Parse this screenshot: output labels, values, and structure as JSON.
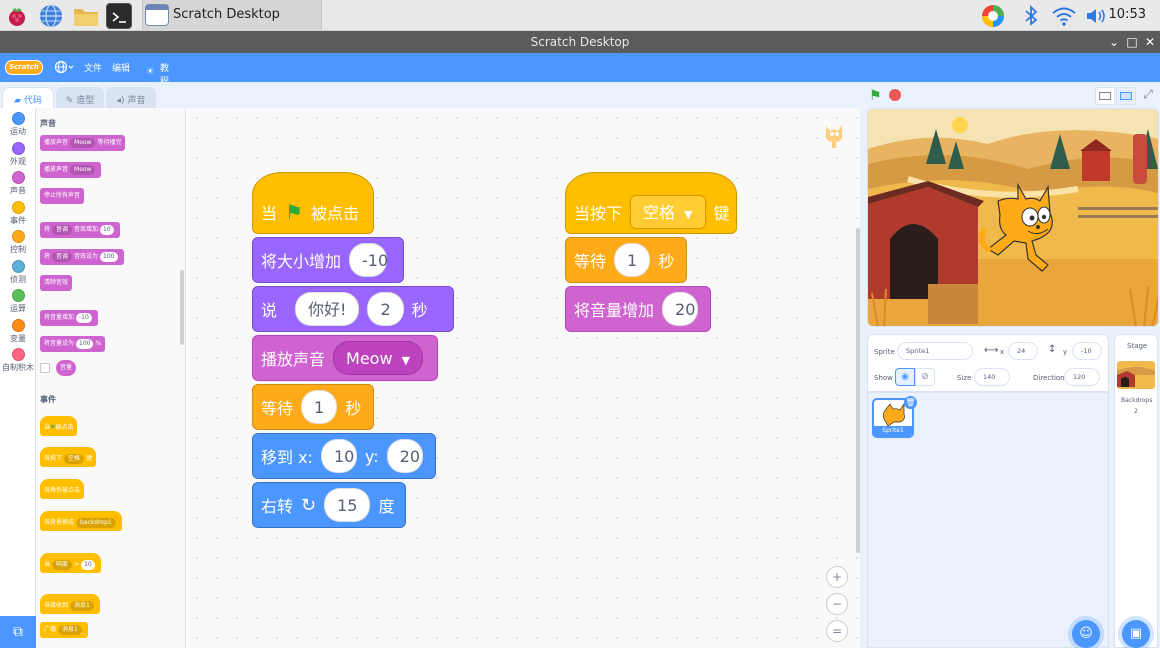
{
  "taskbar": {
    "window_title": "Scratch Desktop",
    "clock": "10:53"
  },
  "window": {
    "title": "Scratch Desktop"
  },
  "menubar": {
    "logo": "Scratch",
    "file": "文件",
    "edit": "编辑",
    "tutorials": "教程"
  },
  "tabs": {
    "code": "代码",
    "costumes": "造型",
    "sounds": "声音"
  },
  "categories": [
    {
      "label": "运动",
      "color": "#4c97ff"
    },
    {
      "label": "外观",
      "color": "#9966ff"
    },
    {
      "label": "声音",
      "color": "#cf63cf"
    },
    {
      "label": "事件",
      "color": "#ffbf00"
    },
    {
      "label": "控制",
      "color": "#ffab19"
    },
    {
      "label": "侦测",
      "color": "#5cb1d6"
    },
    {
      "label": "运算",
      "color": "#59c059"
    },
    {
      "label": "变量",
      "color": "#ff8c1a"
    },
    {
      "label": "自制积木",
      "color": "#ff6680"
    }
  ],
  "palette": {
    "sound_heading": "声音",
    "events_heading": "事件",
    "sound_blocks": {
      "play_until_done": "播放声音",
      "play_until_done_sound": "Meow",
      "play_until_done_suffix": "等待播完",
      "start_sound": "播放声音",
      "start_sound_sound": "Meow",
      "stop_all": "停止所有声音",
      "change_effect_prefix": "将",
      "change_effect_dd": "音调",
      "change_effect_mid": "音效增加",
      "change_effect_val": "10",
      "set_effect_prefix": "将",
      "set_effect_dd": "音调",
      "set_effect_mid": "音效设为",
      "set_effect_val": "100",
      "clear_effects": "清除音效",
      "change_volume": "将音量增加",
      "change_volume_val": "-10",
      "set_volume": "将音量设为",
      "set_volume_val": "100",
      "set_volume_unit": "%",
      "volume_reporter": "音量"
    },
    "event_blocks": {
      "when_flag_a": "当",
      "when_flag_b": "被点击",
      "when_key_a": "当按下",
      "when_key_dd": "空格",
      "when_key_b": "键",
      "when_sprite_clicked": "当角色被点击",
      "when_backdrop": "当背景换成",
      "when_backdrop_dd": "backdrop1",
      "when_gt_a": "当",
      "when_gt_dd": "响度",
      "when_gt_op": ">",
      "when_gt_val": "10",
      "when_receive": "当接收到",
      "when_receive_dd": "消息1",
      "broadcast": "广播",
      "broadcast_dd": "消息1"
    }
  },
  "script1": {
    "when_flag_a": "当",
    "when_flag_b": "被点击",
    "change_size": "将大小增加",
    "change_size_val": "-10",
    "say": "说",
    "say_text": "你好!",
    "say_secs": "2",
    "say_unit": "秒",
    "play_sound": "播放声音",
    "play_sound_val": "Meow",
    "wait": "等待",
    "wait_val": "1",
    "wait_unit": "秒",
    "goto": "移到 x:",
    "goto_x": "10",
    "goto_y_label": "y:",
    "goto_y": "20",
    "turn": "右转",
    "turn_val": "15",
    "turn_unit": "度"
  },
  "script2": {
    "when_key_a": "当按下",
    "when_key_dd": "空格",
    "when_key_b": "键",
    "wait": "等待",
    "wait_val": "1",
    "wait_unit": "秒",
    "change_volume": "将音量增加",
    "change_volume_val": "20"
  },
  "sprite_info": {
    "sprite_label": "Sprite",
    "sprite_name": "Sprite1",
    "x_label": "x",
    "x_val": "24",
    "y_label": "y",
    "y_val": "-10",
    "show_label": "Show",
    "size_label": "Size",
    "size_val": "140",
    "direction_label": "Direction",
    "direction_val": "120"
  },
  "sprite_list": {
    "items": [
      "Sprite1"
    ]
  },
  "stage_panel": {
    "title": "Stage",
    "backdrops_label": "Backdrops",
    "backdrops_count": "2"
  }
}
